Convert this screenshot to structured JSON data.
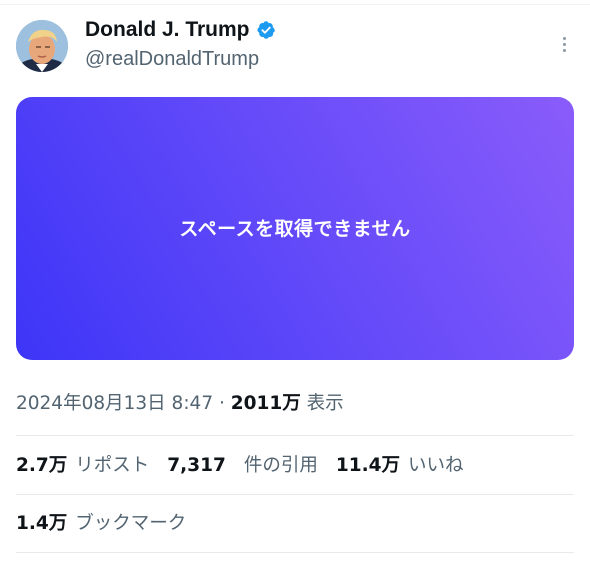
{
  "author": {
    "display_name": "Donald J. Trump",
    "handle": "@realDonaldTrump",
    "verified_icon": "verified-badge-icon",
    "avatar_icon": "avatar-photo"
  },
  "media": {
    "message": "スペースを取得できません"
  },
  "meta": {
    "timestamp": "2024年08月13日 8:47",
    "separator": "·",
    "views_count": "2011万",
    "views_label": "表示"
  },
  "stats": {
    "reposts_count": "2.7万",
    "reposts_label": "リポスト",
    "quotes_count": "7,317",
    "quotes_label": "件の引用",
    "likes_count": "11.4万",
    "likes_label": "いいね",
    "bookmarks_count": "1.4万",
    "bookmarks_label": "ブックマーク"
  },
  "colors": {
    "verified_blue": "#1d9bf0",
    "secondary_text": "#536471",
    "primary_text": "#0f1419",
    "card_gradient_start": "#3d35f7",
    "card_gradient_end": "#8a5cfa"
  }
}
